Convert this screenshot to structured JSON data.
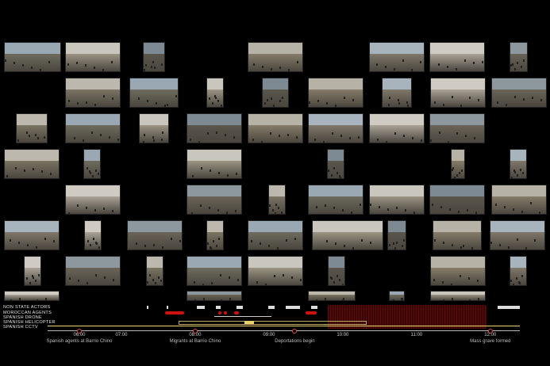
{
  "timeline": {
    "lanes": [
      "NON STATE ACTORS",
      "MOROCCAN AGENTS",
      "SPANISH DRONE",
      "SPANISH HELICOPTER",
      "SPANISH CCTV"
    ],
    "hours": [
      "06:00",
      "07:00",
      "08:00",
      "09:00",
      "10:00",
      "11:00",
      "12:00"
    ],
    "events": [
      {
        "label": "Spanish agents at Barrio Chino",
        "hour": 6.0
      },
      {
        "label": "Migrants at Barrio Chino",
        "hour": 8.0
      },
      {
        "label": "Deportations begin",
        "hour": 9.35
      },
      {
        "label": "Mass grave formed",
        "hour": 12.0
      }
    ],
    "colors": {
      "accent": "#e04a4a",
      "drone": "#e6d36a",
      "red_block": "#5a0d0d",
      "axis": "#b9b9b9"
    }
  },
  "thumb_count": 60
}
